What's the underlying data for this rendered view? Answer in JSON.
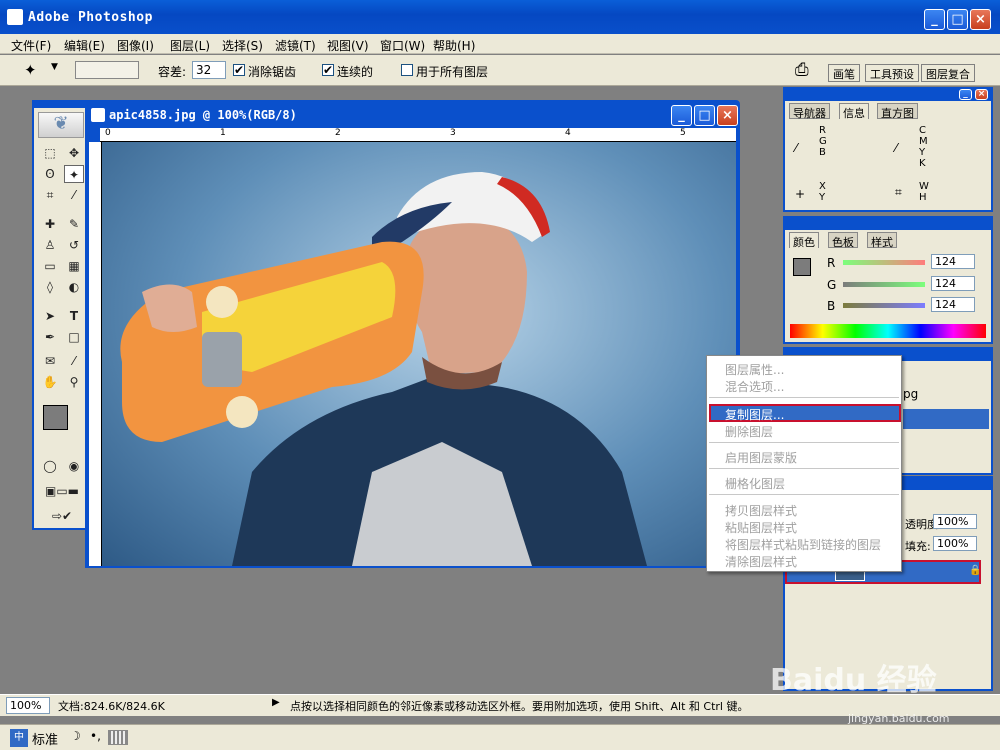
{
  "app": {
    "title": "Adobe Photoshop"
  },
  "menu": [
    "文件(F)",
    "编辑(E)",
    "图像(I)",
    "图层(L)",
    "选择(S)",
    "滤镜(T)",
    "视图(V)",
    "窗口(W)",
    "帮助(H)"
  ],
  "options": {
    "tolerance_label": "容差:",
    "tolerance_value": "32",
    "antialias_label": "消除锯齿",
    "contiguous_label": "连续的",
    "all_layers_label": "用于所有图层"
  },
  "wells": [
    "画笔",
    "工具预设",
    "图层复合"
  ],
  "document": {
    "title": "apic4858.jpg @ 100%(RGB/8)",
    "ruler_marks": [
      "0",
      "1",
      "2",
      "3",
      "4",
      "5"
    ]
  },
  "navigator_panel": {
    "tabs": [
      "导航器",
      "信息",
      "直方图"
    ],
    "active_tab": "信息",
    "labels_left": [
      "R",
      "G",
      "B"
    ],
    "labels_right": [
      "C",
      "M",
      "Y",
      "K"
    ],
    "xy": [
      "X",
      "Y"
    ],
    "wh": [
      "W",
      "H"
    ]
  },
  "color_panel": {
    "tabs": [
      "颜色",
      "色板",
      "样式"
    ],
    "active_tab": "颜色",
    "channels": [
      {
        "label": "R",
        "value": "124"
      },
      {
        "label": "G",
        "value": "124"
      },
      {
        "label": "B",
        "value": "124"
      }
    ]
  },
  "layers_panel": {
    "partial_text": "pg",
    "opacity_label": "透明度:",
    "opacity_value": "100%",
    "fill_label": "填充:",
    "fill_value": "100%"
  },
  "context_menu": {
    "items": [
      "图层属性...",
      "混合选项...",
      "复制图层...",
      "删除图层",
      "启用图层蒙版",
      "栅格化图层",
      "拷贝图层样式",
      "粘贴图层样式",
      "将图层样式粘贴到链接的图层",
      "清除图层样式"
    ],
    "selected": "复制图层..."
  },
  "status": {
    "zoom": "100%",
    "doc_info": "文档:824.6K/824.6K",
    "hint": "点按以选择相同颜色的邻近像素或移动选区外框。要用附加选项，使用 Shift、Alt 和 Ctrl 键。"
  },
  "taskbar": {
    "ime_label": "标准"
  },
  "watermark": {
    "text": "Baidu 经验",
    "url": "jingyan.baidu.com"
  },
  "colors": {
    "xp_blue": "#0a50cc",
    "highlight": "#316ac5",
    "accent_red": "#c8102e",
    "chrome": "#ece9d8"
  }
}
